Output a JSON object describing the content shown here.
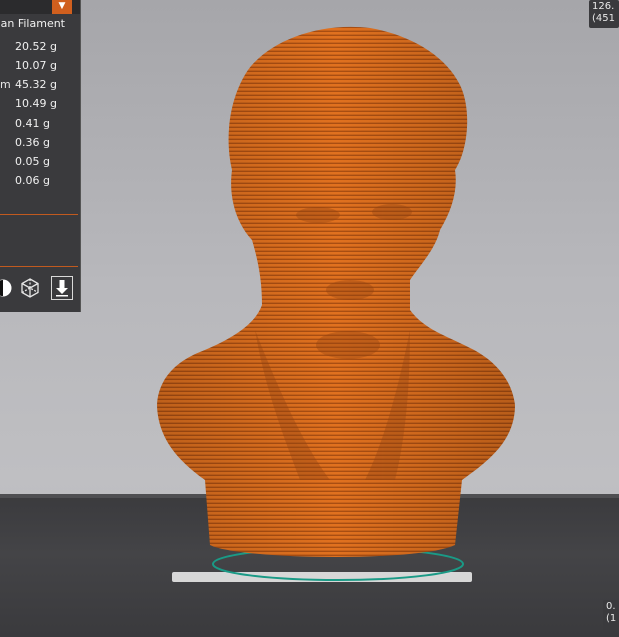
{
  "stats_panel": {
    "title": "lan Filament",
    "rows": [
      {
        "label": "",
        "value": "20.52 g"
      },
      {
        "label": "",
        "value": "10.07 g"
      },
      {
        "label": "m",
        "value": "45.32 g"
      },
      {
        "label": "",
        "value": "10.49 g"
      },
      {
        "label": "",
        "value": "0.41 g"
      },
      {
        "label": "",
        "value": "0.36 g"
      },
      {
        "label": "",
        "value": "0.05 g"
      },
      {
        "label": "",
        "value": "0.06 g"
      }
    ],
    "icons": [
      "view-toggle-icon",
      "cube-view-icon",
      "export-download-icon"
    ],
    "accent": "#d05f1e"
  },
  "top_right_readout": {
    "line1": "126.",
    "line2": "(451"
  },
  "bottom_right_readout": {
    "line1": "0.",
    "line2": "(1"
  },
  "model": {
    "color": "#e07020",
    "name_shown": false
  }
}
